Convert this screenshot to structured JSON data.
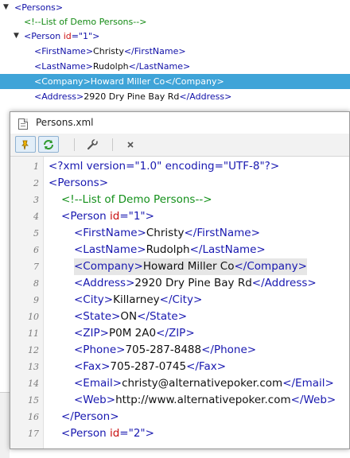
{
  "tree": {
    "nodes": [
      {
        "expander": "▼",
        "open": "<",
        "tag": "Persons",
        "close": ">"
      },
      {
        "comment": "<!--List of Demo Persons-->"
      },
      {
        "expander": "▼",
        "open": "<",
        "tag": "Person",
        "attr": "id",
        "eq": "=",
        "val": "\"1\"",
        "close": ">"
      },
      {
        "open": "<",
        "tag": "FirstName",
        "mid": ">",
        "text": "Christy",
        "endopen": "</",
        "endtag": "FirstName",
        "close": ">"
      },
      {
        "open": "<",
        "tag": "LastName",
        "mid": ">",
        "text": "Rudolph",
        "endopen": "</",
        "endtag": "LastName",
        "close": ">"
      },
      {
        "open": "<",
        "tag": "Company",
        "mid": ">",
        "text": "Howard Miller Co",
        "endopen": "</",
        "endtag": "Company",
        "close": ">"
      },
      {
        "open": "<",
        "tag": "Address",
        "mid": ">",
        "text": "2920 Dry Pine Bay Rd",
        "endopen": "</",
        "endtag": "Address",
        "close": ">"
      }
    ]
  },
  "window": {
    "title": "Persons.xml",
    "toolbar_icons": [
      "pin-icon",
      "refresh-icon",
      "wrench-icon",
      "close-icon"
    ]
  },
  "editor": {
    "lines": [
      {
        "num": "1",
        "parts": [
          {
            "k": "g",
            "s": "<?xml version=\"1.0\" encoding=\"UTF-8\"?>"
          }
        ]
      },
      {
        "num": "2",
        "parts": [
          {
            "k": "g",
            "s": "<"
          },
          {
            "k": "g",
            "s": "Persons"
          },
          {
            "k": "g",
            "s": ">"
          }
        ]
      },
      {
        "num": "3",
        "parts": [
          {
            "k": "c",
            "s": "<!--List of Demo Persons-->"
          }
        ]
      },
      {
        "num": "4",
        "parts": [
          {
            "k": "g",
            "s": "<"
          },
          {
            "k": "g",
            "s": "Person"
          },
          {
            "k": "t",
            "s": " "
          },
          {
            "k": "a",
            "s": "id"
          },
          {
            "k": "g",
            "s": "="
          },
          {
            "k": "v",
            "s": "\"1\""
          },
          {
            "k": "g",
            "s": ">"
          }
        ]
      },
      {
        "num": "5",
        "parts": [
          {
            "k": "g",
            "s": "<FirstName>"
          },
          {
            "k": "t",
            "s": "Christy"
          },
          {
            "k": "g",
            "s": "</FirstName>"
          }
        ]
      },
      {
        "num": "6",
        "parts": [
          {
            "k": "g",
            "s": "<LastName>"
          },
          {
            "k": "t",
            "s": "Rudolph"
          },
          {
            "k": "g",
            "s": "</LastName>"
          }
        ]
      },
      {
        "num": "7",
        "parts": [
          {
            "k": "g",
            "s": "<Company>"
          },
          {
            "k": "t",
            "s": "Howard Miller Co"
          },
          {
            "k": "g",
            "s": "</Company>"
          }
        ]
      },
      {
        "num": "8",
        "parts": [
          {
            "k": "g",
            "s": "<Address>"
          },
          {
            "k": "t",
            "s": "2920 Dry Pine Bay Rd"
          },
          {
            "k": "g",
            "s": "</Address>"
          }
        ]
      },
      {
        "num": "9",
        "parts": [
          {
            "k": "g",
            "s": "<City>"
          },
          {
            "k": "t",
            "s": "Killarney"
          },
          {
            "k": "g",
            "s": "</City>"
          }
        ]
      },
      {
        "num": "10",
        "parts": [
          {
            "k": "g",
            "s": "<State>"
          },
          {
            "k": "t",
            "s": "ON"
          },
          {
            "k": "g",
            "s": "</State>"
          }
        ]
      },
      {
        "num": "11",
        "parts": [
          {
            "k": "g",
            "s": "<ZIP>"
          },
          {
            "k": "t",
            "s": "P0M 2A0"
          },
          {
            "k": "g",
            "s": "</ZIP>"
          }
        ]
      },
      {
        "num": "12",
        "parts": [
          {
            "k": "g",
            "s": "<Phone>"
          },
          {
            "k": "t",
            "s": "705-287-8488"
          },
          {
            "k": "g",
            "s": "</Phone>"
          }
        ]
      },
      {
        "num": "13",
        "parts": [
          {
            "k": "g",
            "s": "<Fax>"
          },
          {
            "k": "t",
            "s": "705-287-0745"
          },
          {
            "k": "g",
            "s": "</Fax>"
          }
        ]
      },
      {
        "num": "14",
        "parts": [
          {
            "k": "g",
            "s": "<Email>"
          },
          {
            "k": "t",
            "s": "christy@alternativepoker.com"
          },
          {
            "k": "g",
            "s": "</Email>"
          }
        ]
      },
      {
        "num": "15",
        "parts": [
          {
            "k": "g",
            "s": "<Web>"
          },
          {
            "k": "t",
            "s": "http://www.alternativepoker.com"
          },
          {
            "k": "g",
            "s": "</Web>"
          }
        ]
      },
      {
        "num": "16",
        "parts": [
          {
            "k": "g",
            "s": "</Person>"
          }
        ]
      },
      {
        "num": "17",
        "parts": [
          {
            "k": "g",
            "s": "<Person "
          },
          {
            "k": "a",
            "s": "id"
          },
          {
            "k": "g",
            "s": "="
          },
          {
            "k": "v",
            "s": "\"2\""
          },
          {
            "k": "g",
            "s": ">"
          }
        ]
      }
    ]
  },
  "colors": {
    "selection": "#3fa4d8",
    "tag": "#1818b0",
    "attribute": "#c81010",
    "comment": "#13901a",
    "gutter": "#f3f3f3"
  }
}
